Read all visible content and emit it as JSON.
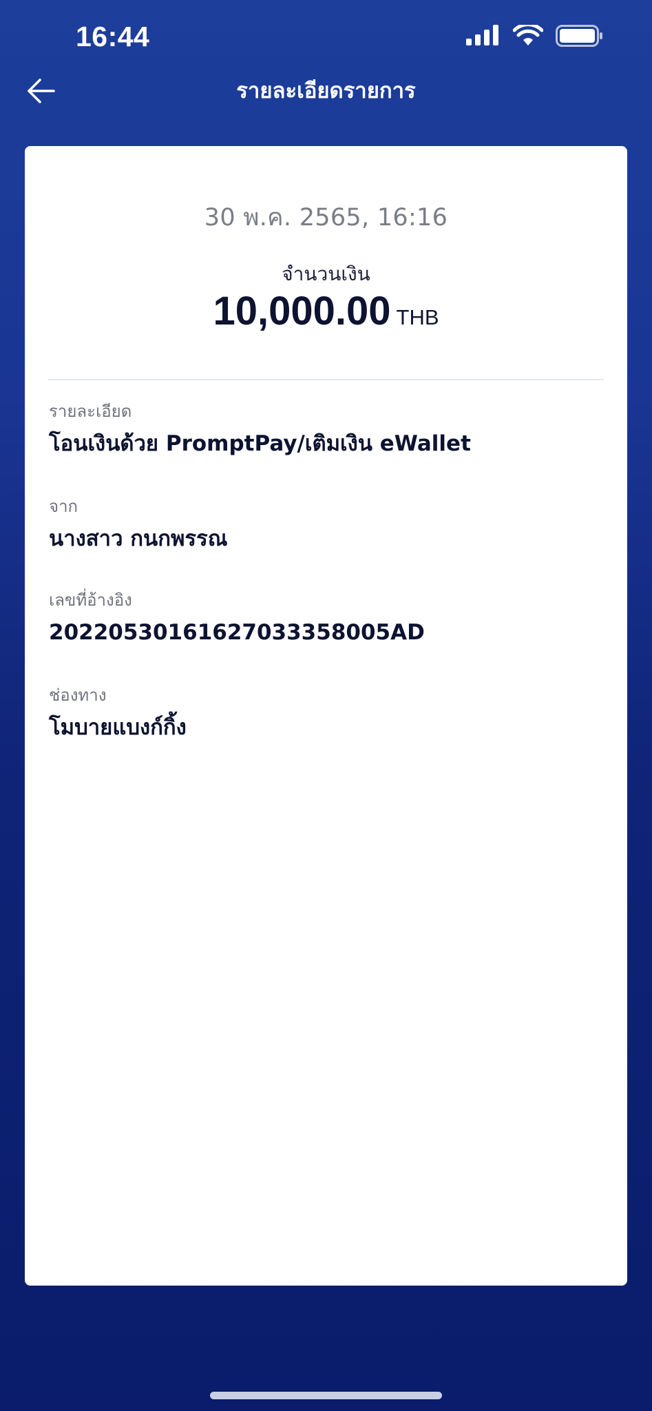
{
  "status_bar": {
    "time": "16:44",
    "icons": [
      "cellular-signal-icon",
      "wifi-icon",
      "battery-icon"
    ]
  },
  "header": {
    "title": "รายละเอียดรายการ",
    "back_icon": "arrow-left-icon"
  },
  "transaction": {
    "datetime": "30 พ.ค. 2565, 16:16",
    "amount_label": "จำนวนเงิน",
    "amount": "10,000.00",
    "currency": "THB"
  },
  "details": [
    {
      "label": "รายละเอียด",
      "value": "โอนเงินด้วย PromptPay/เติมเงิน eWallet"
    },
    {
      "label": "จาก",
      "value": "นางสาว กนกพรรณ"
    },
    {
      "label": "เลขที่อ้างอิง",
      "value": "20220530161627033358005AD"
    },
    {
      "label": "ช่องทาง",
      "value": "โมบายแบงก์กิ้ง"
    }
  ],
  "colors": {
    "background_top": "#1d3e9b",
    "background_bottom": "#0a1c6b",
    "card": "#ffffff",
    "primary_text": "#0d1330",
    "secondary_text": "#6f727d"
  }
}
